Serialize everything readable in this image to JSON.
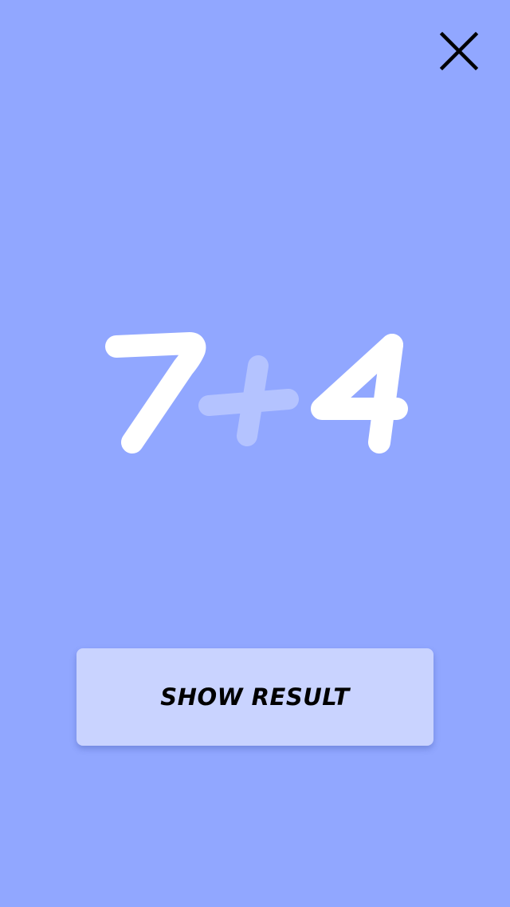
{
  "app": {
    "background_color": "#91a7ff"
  },
  "header": {
    "close_icon": "close-icon"
  },
  "equation": {
    "left_operand": "7",
    "operator": "+",
    "right_operand": "4",
    "digit_color": "#ffffff",
    "operator_color": "#b4c3ff"
  },
  "actions": {
    "show_result_label": "SHOW RESULT",
    "button_color": "#c9d3ff"
  }
}
